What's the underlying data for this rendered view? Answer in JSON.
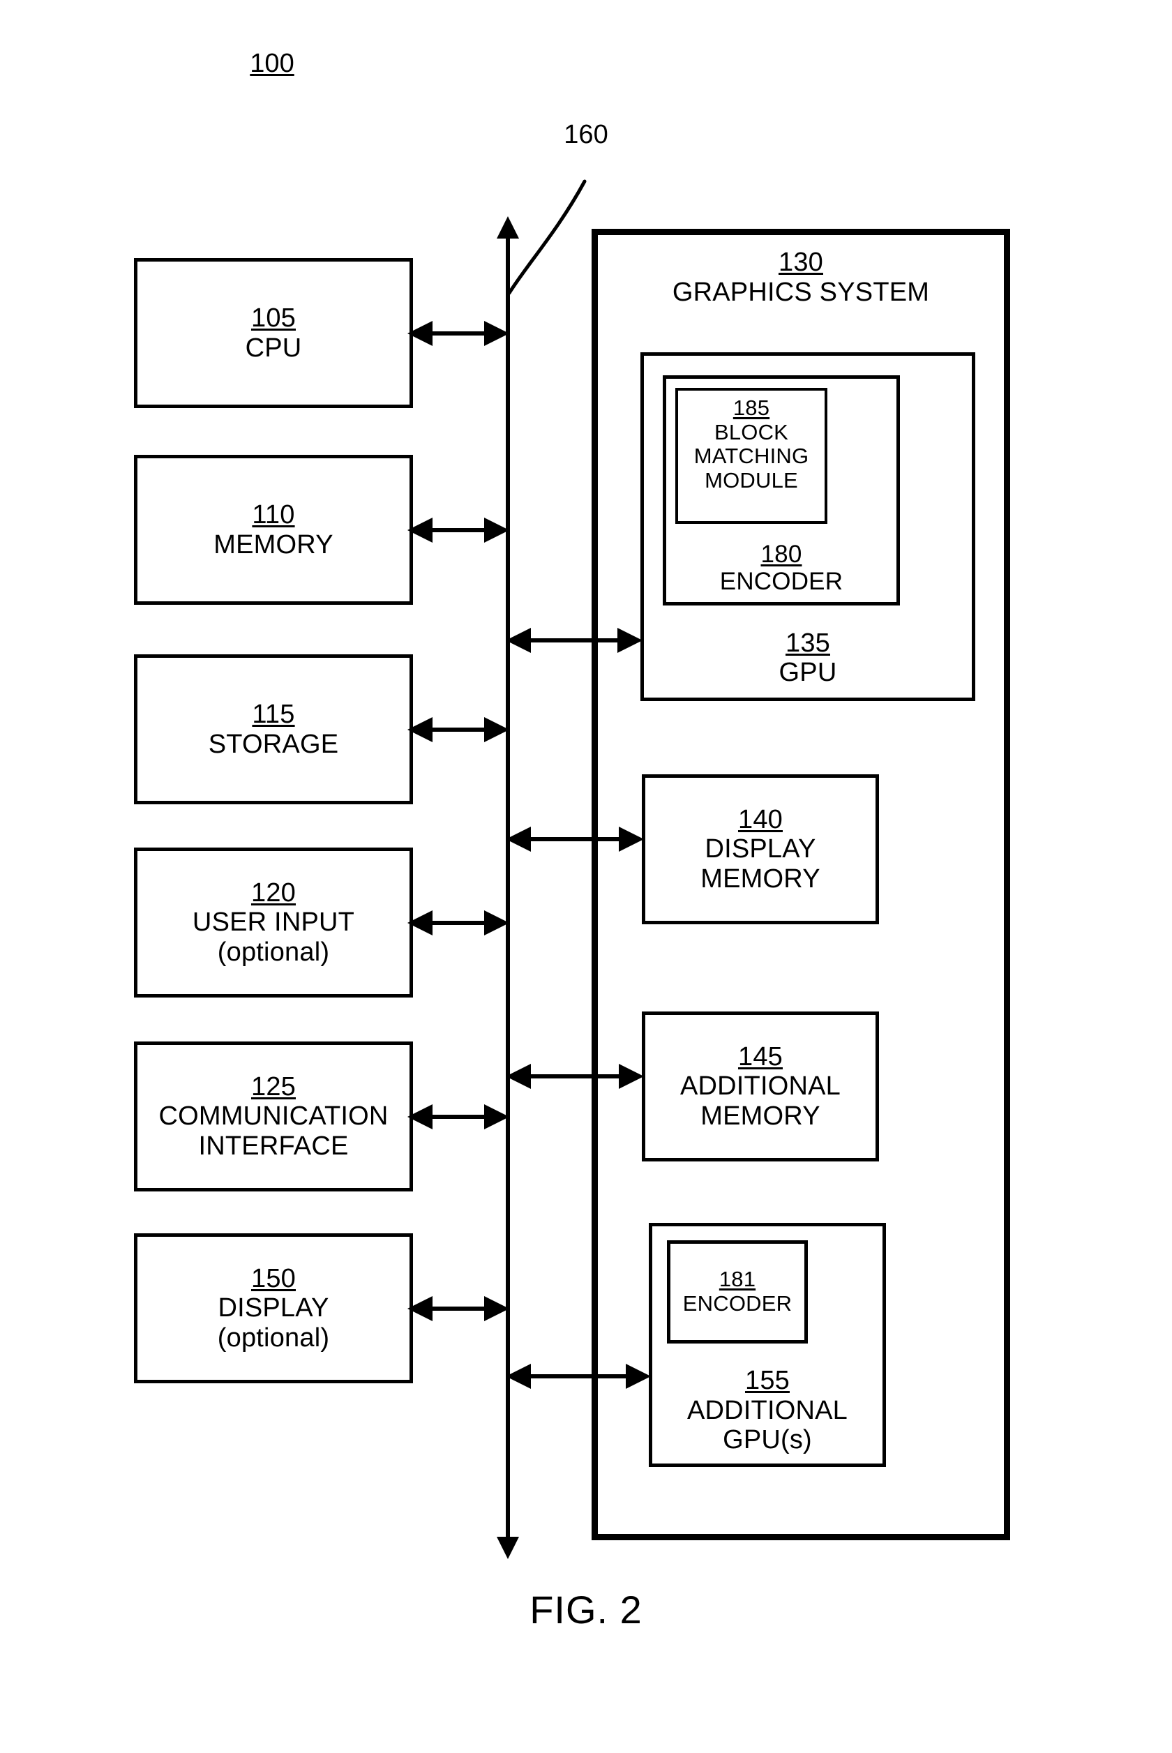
{
  "figure": {
    "caption": "FIG. 2",
    "system_ref": "100",
    "bus_ref": "160"
  },
  "left_column": [
    {
      "ref": "105",
      "name": "CPU",
      "note": ""
    },
    {
      "ref": "110",
      "name": "MEMORY",
      "note": ""
    },
    {
      "ref": "115",
      "name": "STORAGE",
      "note": ""
    },
    {
      "ref": "120",
      "name": "USER INPUT",
      "note": "(optional)"
    },
    {
      "ref": "125",
      "name": "COMMUNICATION",
      "name2": "INTERFACE",
      "note": ""
    },
    {
      "ref": "150",
      "name": "DISPLAY",
      "note": "(optional)"
    }
  ],
  "graphics_system": {
    "ref": "130",
    "name": "GRAPHICS SYSTEM",
    "gpu": {
      "ref": "135",
      "name": "GPU",
      "encoder": {
        "ref": "180",
        "name": "ENCODER",
        "block_matching_module": {
          "ref": "185",
          "line1": "BLOCK",
          "line2": "MATCHING",
          "line3": "MODULE"
        }
      }
    },
    "display_memory": {
      "ref": "140",
      "line1": "DISPLAY",
      "line2": "MEMORY"
    },
    "additional_memory": {
      "ref": "145",
      "line1": "ADDITIONAL",
      "line2": "MEMORY"
    },
    "additional_gpus": {
      "ref": "155",
      "line1": "ADDITIONAL",
      "line2": "GPU(s)",
      "encoder": {
        "ref": "181",
        "name": "ENCODER"
      }
    }
  },
  "colors": {
    "ink": "#000000",
    "paper": "#ffffff"
  }
}
